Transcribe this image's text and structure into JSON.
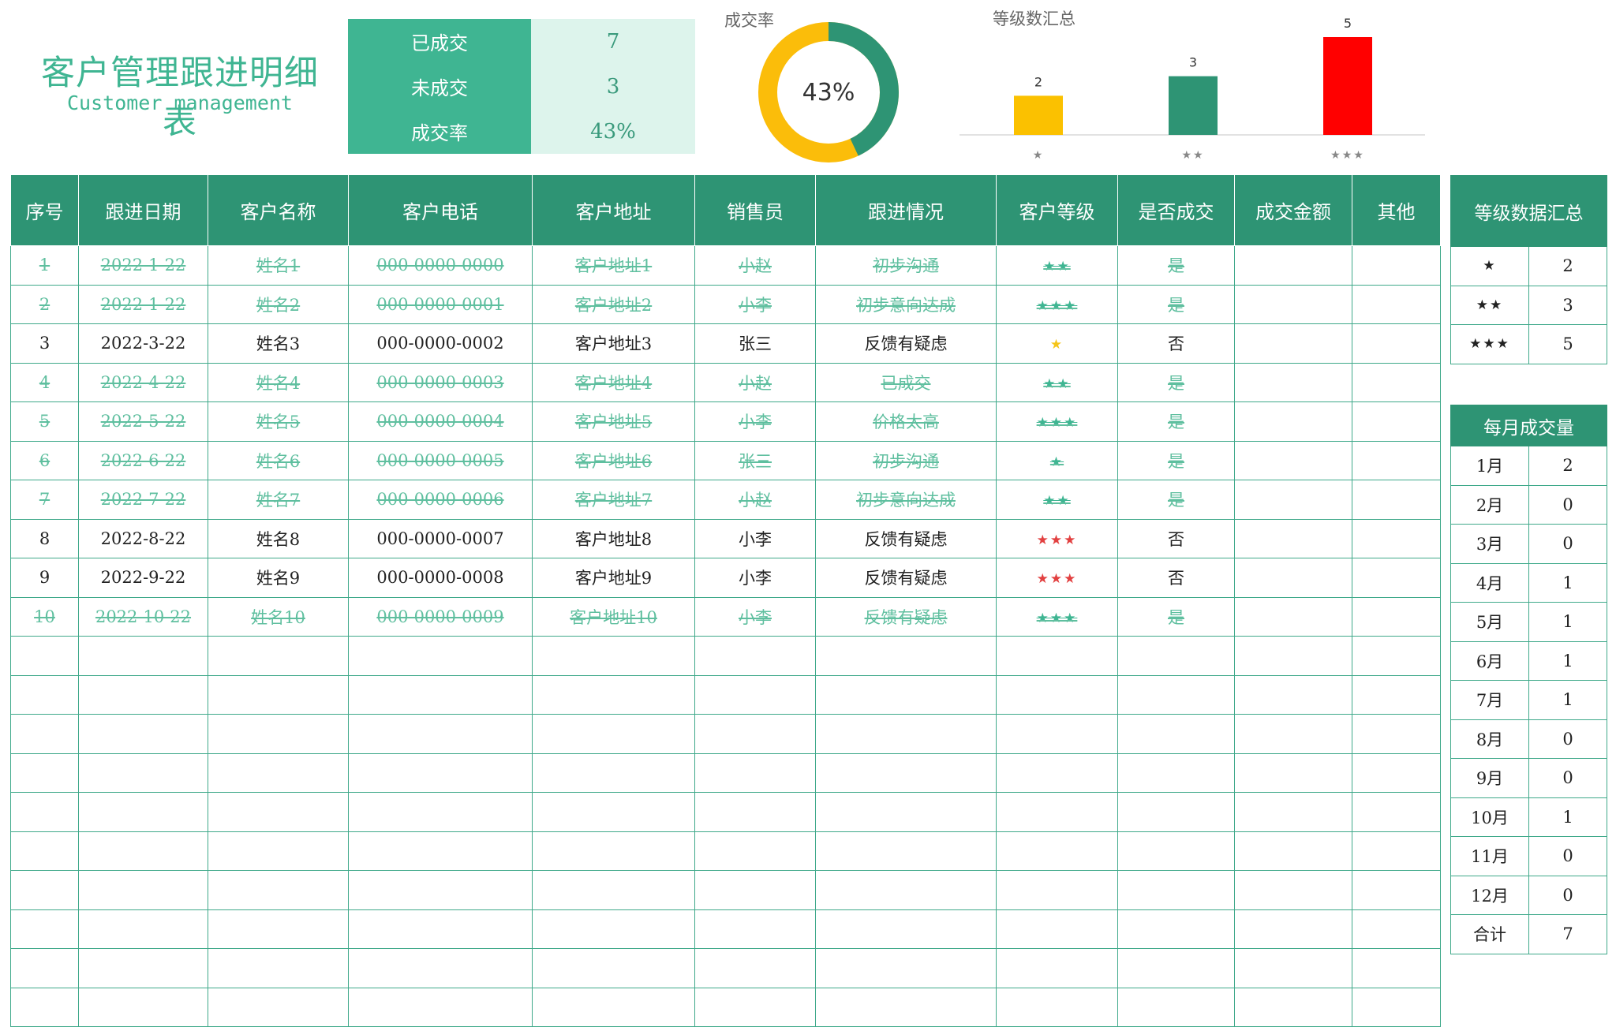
{
  "title": {
    "cn": "客户管理跟进明细表",
    "en": "Customer management"
  },
  "summary": [
    {
      "label": "已成交",
      "value": "7"
    },
    {
      "label": "未成交",
      "value": "3"
    },
    {
      "label": "成交率",
      "value": "43%"
    }
  ],
  "donut": {
    "title": "成交率",
    "label": "43%",
    "value": 43,
    "colors": {
      "done": "#2e9474",
      "rest": "#fbbd0a"
    }
  },
  "chart_data": {
    "type": "bar",
    "title": "等级数汇总",
    "categories": [
      "★",
      "★★",
      "★★★"
    ],
    "values": [
      2,
      3,
      5
    ],
    "colors": [
      "#fbc100",
      "#2e9474",
      "#ff0000"
    ],
    "ylim": [
      0,
      5
    ],
    "grid": false
  },
  "table": {
    "headers": [
      "序号",
      "跟进日期",
      "客户名称",
      "客户电话",
      "客户地址",
      "销售员",
      "跟进情况",
      "客户等级",
      "是否成交",
      "成交金额",
      "其他"
    ],
    "rows": [
      {
        "done": true,
        "stars": "★★",
        "star_color": "green",
        "cells": [
          "1",
          "2022-1-22",
          "姓名1",
          "000-0000-0000",
          "客户地址1",
          "小赵",
          "初步沟通",
          "是",
          "",
          ""
        ]
      },
      {
        "done": true,
        "stars": "★★★",
        "star_color": "green",
        "cells": [
          "2",
          "2022-1-22",
          "姓名2",
          "000-0000-0001",
          "客户地址2",
          "小李",
          "初步意向达成",
          "是",
          "",
          ""
        ]
      },
      {
        "done": false,
        "stars": "★",
        "star_color": "gold",
        "cells": [
          "3",
          "2022-3-22",
          "姓名3",
          "000-0000-0002",
          "客户地址3",
          "张三",
          "反馈有疑虑",
          "否",
          "",
          ""
        ]
      },
      {
        "done": true,
        "stars": "★★",
        "star_color": "green",
        "cells": [
          "4",
          "2022-4-22",
          "姓名4",
          "000-0000-0003",
          "客户地址4",
          "小赵",
          "已成交",
          "是",
          "",
          ""
        ]
      },
      {
        "done": true,
        "stars": "★★★",
        "star_color": "green",
        "cells": [
          "5",
          "2022-5-22",
          "姓名5",
          "000-0000-0004",
          "客户地址5",
          "小李",
          "价格太高",
          "是",
          "",
          ""
        ]
      },
      {
        "done": true,
        "stars": "★",
        "star_color": "green",
        "cells": [
          "6",
          "2022-6-22",
          "姓名6",
          "000-0000-0005",
          "客户地址6",
          "张三",
          "初步沟通",
          "是",
          "",
          ""
        ]
      },
      {
        "done": true,
        "stars": "★★",
        "star_color": "green",
        "cells": [
          "7",
          "2022-7-22",
          "姓名7",
          "000-0000-0006",
          "客户地址7",
          "小赵",
          "初步意向达成",
          "是",
          "",
          ""
        ]
      },
      {
        "done": false,
        "stars": "★★★",
        "star_color": "red",
        "cells": [
          "8",
          "2022-8-22",
          "姓名8",
          "000-0000-0007",
          "客户地址8",
          "小李",
          "反馈有疑虑",
          "否",
          "",
          ""
        ]
      },
      {
        "done": false,
        "stars": "★★★",
        "star_color": "red",
        "cells": [
          "9",
          "2022-9-22",
          "姓名9",
          "000-0000-0008",
          "客户地址9",
          "小李",
          "反馈有疑虑",
          "否",
          "",
          ""
        ]
      },
      {
        "done": true,
        "stars": "★★★",
        "star_color": "green",
        "cells": [
          "10",
          "2022-10-22",
          "姓名10",
          "000-0000-0009",
          "客户地址10",
          "小李",
          "反馈有疑虑",
          "是",
          "",
          ""
        ]
      }
    ],
    "empty_rows": 10
  },
  "level_summary": {
    "header": "等级数据汇总",
    "rows": [
      {
        "level": "★",
        "count": "2"
      },
      {
        "level": "★★",
        "count": "3"
      },
      {
        "level": "★★★",
        "count": "5"
      }
    ]
  },
  "monthly": {
    "header": "每月成交量",
    "rows": [
      {
        "month": "1月",
        "count": "2"
      },
      {
        "month": "2月",
        "count": "0"
      },
      {
        "month": "3月",
        "count": "0"
      },
      {
        "month": "4月",
        "count": "1"
      },
      {
        "month": "5月",
        "count": "1"
      },
      {
        "month": "6月",
        "count": "1"
      },
      {
        "month": "7月",
        "count": "1"
      },
      {
        "month": "8月",
        "count": "0"
      },
      {
        "month": "9月",
        "count": "0"
      },
      {
        "month": "10月",
        "count": "1"
      },
      {
        "month": "11月",
        "count": "0"
      },
      {
        "month": "12月",
        "count": "0"
      },
      {
        "month": "合计",
        "count": "7"
      }
    ]
  }
}
